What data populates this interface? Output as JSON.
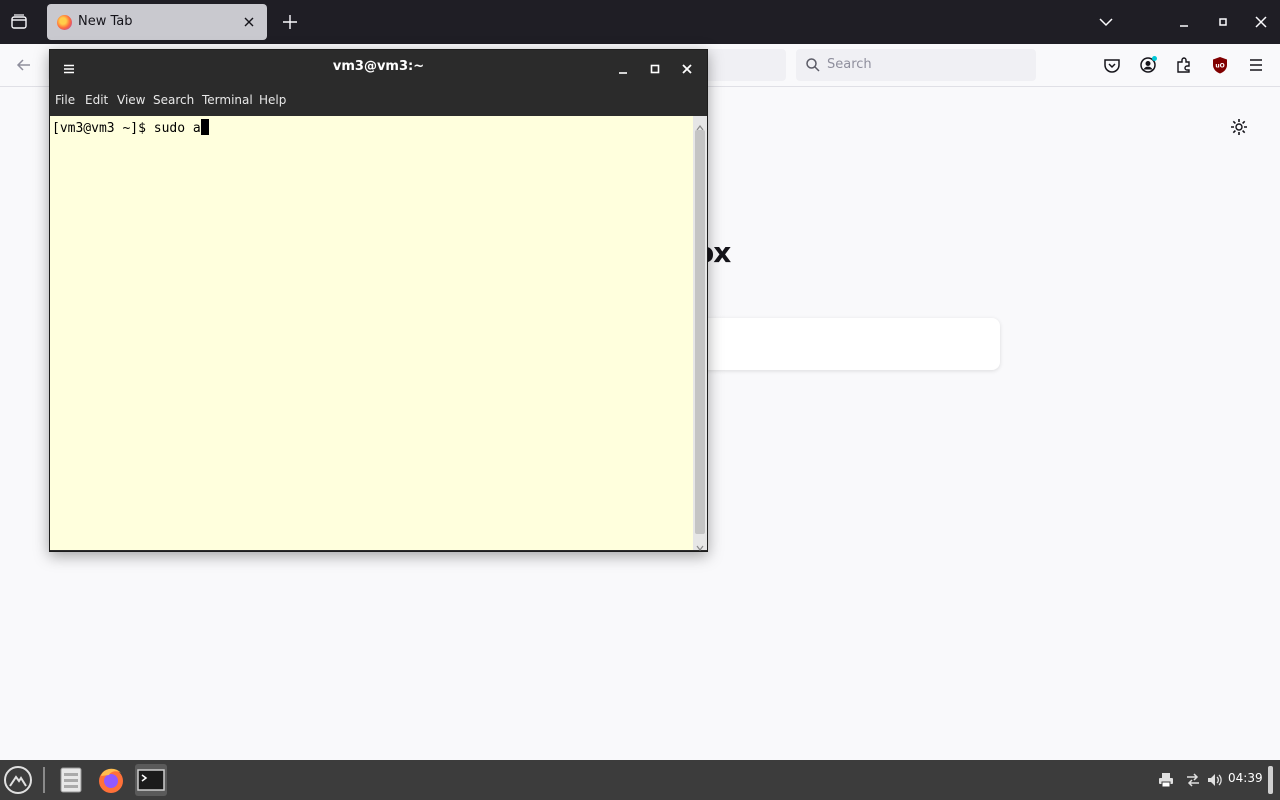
{
  "firefox": {
    "tab_title": "New Tab",
    "search_placeholder": "Search",
    "brand_fragment": "ox"
  },
  "terminal": {
    "title": "vm3@vm3:~",
    "menu": [
      "File",
      "Edit",
      "View",
      "Search",
      "Terminal",
      "Help"
    ],
    "prompt": "[vm3@vm3 ~]$ ",
    "command": "sudo a"
  },
  "taskbar": {
    "clock": "04:39"
  },
  "colors": {
    "terminal_bg": "#ffffdd",
    "titlebar": "#2b2b2b",
    "taskbar": "#3c3c3c",
    "firefox_tabbar": "#1f1e25"
  }
}
